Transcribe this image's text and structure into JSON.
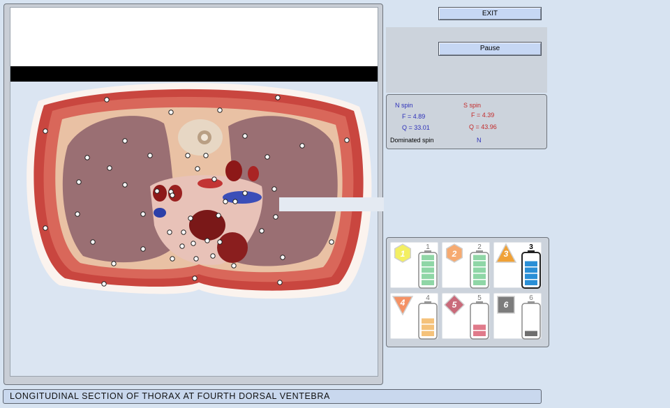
{
  "buttons": {
    "exit_label": "EXIT",
    "pause_label": "Pause"
  },
  "spin": {
    "n_title": "N spin",
    "n_f": "F =  4.89",
    "n_q": "Q = 33.01",
    "s_title": "S spin",
    "s_f": "F =  4.39",
    "s_q": "Q = 43.96",
    "dominated_label": "Dominated spin",
    "dominated_value": "N"
  },
  "levels": [
    {
      "number": "1",
      "shape": "hexagon",
      "badge_color": "#f3ef62",
      "fill_color": "#8fd6a6",
      "filled": 5,
      "selected": false
    },
    {
      "number": "2",
      "shape": "hexagon",
      "badge_color": "#f6aa70",
      "fill_color": "#8fd6a6",
      "filled": 5,
      "selected": false
    },
    {
      "number": "3",
      "shape": "triangle-up",
      "badge_color": "#f0a136",
      "fill_color": "#2a8fd6",
      "filled": 4,
      "selected": true
    },
    {
      "number": "4",
      "shape": "triangle-down",
      "badge_color": "#f49265",
      "fill_color": "#f5c27a",
      "filled": 3,
      "selected": false
    },
    {
      "number": "5",
      "shape": "diamond",
      "badge_color": "#c96a7a",
      "fill_color": "#e07a8a",
      "filled": 2,
      "selected": false
    },
    {
      "number": "6",
      "shape": "square",
      "badge_color": "#7c7c7c",
      "fill_color": "#6f6f6f",
      "filled": 1,
      "selected": false
    }
  ],
  "caption": "LONGITUDINAL SECTION OF THORAX AT FOURTH DORSAL VENTEBRA"
}
